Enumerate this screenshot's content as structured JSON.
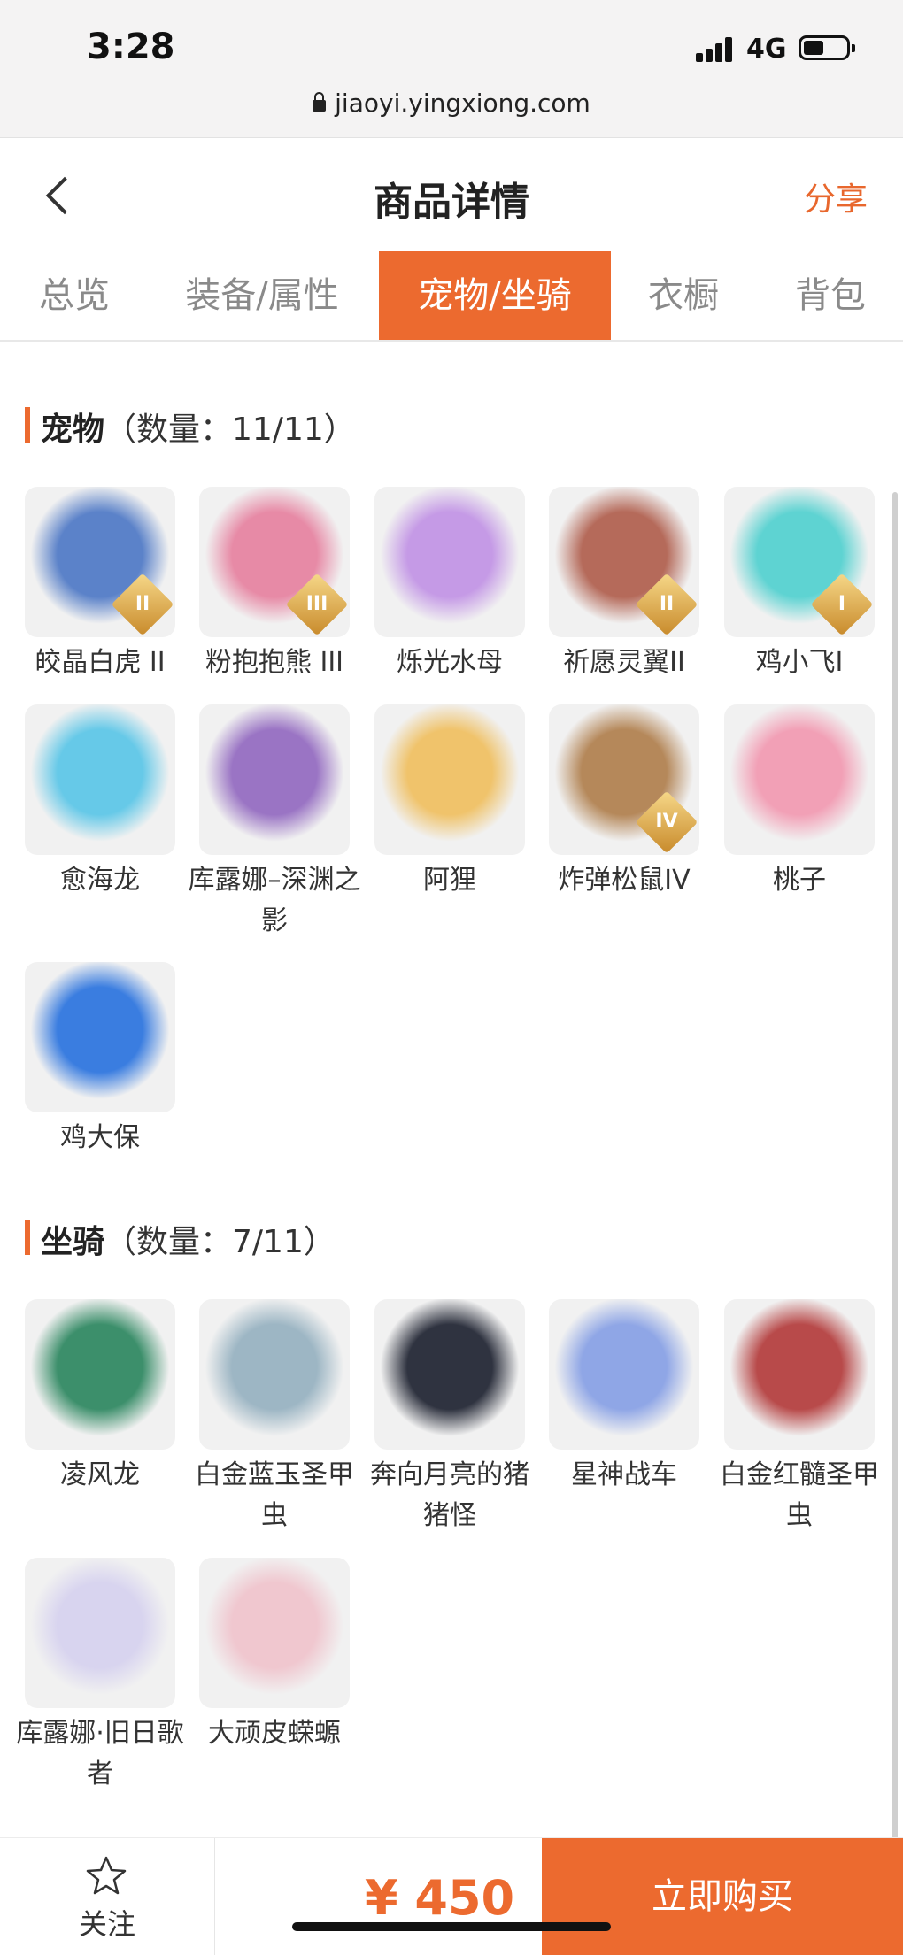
{
  "status": {
    "time": "3:28",
    "network": "4G"
  },
  "url": "jiaoyi.yingxiong.com",
  "header": {
    "title": "商品详情",
    "share_label": "分享"
  },
  "tabs": [
    {
      "label": "总览",
      "active": false
    },
    {
      "label": "装备/属性",
      "active": false
    },
    {
      "label": "宠物/坐骑",
      "active": true
    },
    {
      "label": "衣橱",
      "active": false
    },
    {
      "label": "背包",
      "active": false
    }
  ],
  "pets": {
    "title": "宠物",
    "count_text": "（数量：11/11）",
    "items": [
      {
        "name": "皎晶白虎 II",
        "rank": "II",
        "color": "#5b82c9"
      },
      {
        "name": "粉抱抱熊 III",
        "rank": "III",
        "color": "#e78aa6"
      },
      {
        "name": "烁光水母",
        "rank": "",
        "color": "#c59ae6"
      },
      {
        "name": "祈愿灵翼II",
        "rank": "II",
        "color": "#b56a5a"
      },
      {
        "name": "鸡小飞I",
        "rank": "I",
        "color": "#5ed3d2"
      },
      {
        "name": "愈海龙",
        "rank": "",
        "color": "#66c9e8"
      },
      {
        "name": "库露娜–深渊之影",
        "rank": "",
        "color": "#9a74c4"
      },
      {
        "name": "阿狸",
        "rank": "",
        "color": "#f0c36b"
      },
      {
        "name": "炸弹松鼠IV",
        "rank": "IV",
        "color": "#b5885a"
      },
      {
        "name": "桃子",
        "rank": "",
        "color": "#f2a0b6"
      },
      {
        "name": "鸡大保",
        "rank": "",
        "color": "#3a7de0"
      }
    ]
  },
  "mounts": {
    "title": "坐骑",
    "count_text": "（数量：7/11）",
    "items": [
      {
        "name": "凌风龙",
        "color": "#3c8f6b"
      },
      {
        "name": "白金蓝玉圣甲虫",
        "color": "#9db6c4"
      },
      {
        "name": "奔向月亮的猪猪怪",
        "color": "#2f3340"
      },
      {
        "name": "星神战车",
        "color": "#8fa6e6"
      },
      {
        "name": "白金红髓圣甲虫",
        "color": "#b84a4a"
      },
      {
        "name": "库露娜·旧日歌者",
        "color": "#d8d4ef"
      },
      {
        "name": "大顽皮蝾螈",
        "color": "#f0c7cf"
      }
    ]
  },
  "bottom": {
    "follow_label": "关注",
    "price": "¥ 450",
    "buy_label": "立即购买"
  },
  "colors": {
    "accent": "#ec6a2f"
  }
}
